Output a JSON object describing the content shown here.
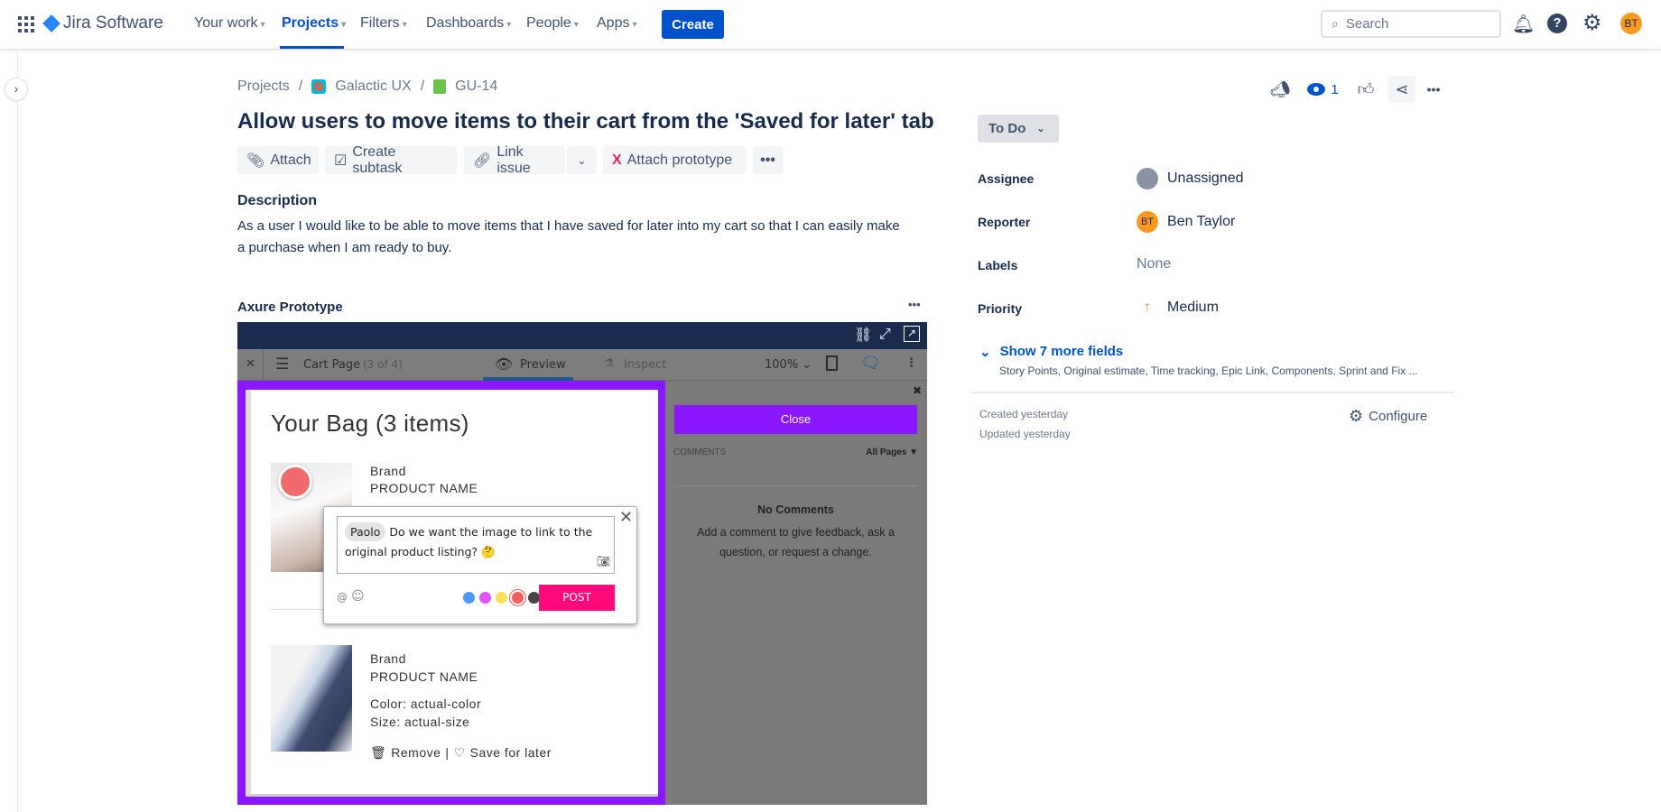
{
  "header": {
    "product": "Jira Software",
    "nav": [
      {
        "label": "Your work"
      },
      {
        "label": "Projects",
        "selected": true
      },
      {
        "label": "Filters"
      },
      {
        "label": "Dashboards"
      },
      {
        "label": "People"
      },
      {
        "label": "Apps"
      }
    ],
    "create": "Create",
    "search_placeholder": "Search",
    "avatar": "BT"
  },
  "breadcrumb": {
    "root": "Projects",
    "project": "Galactic UX",
    "issue": "GU-14"
  },
  "issue": {
    "title": "Allow users to move items to their cart from the 'Saved for later' tab",
    "actions": {
      "attach": "Attach",
      "subtask": "Create subtask",
      "link": "Link issue",
      "prototype": "Attach prototype"
    },
    "description_heading": "Description",
    "description": "As a user I would like to be able to move items that I have saved for later into my cart so that I can easily make a purchase when I am ready to buy.",
    "prototype_heading": "Axure Prototype"
  },
  "prototype": {
    "page": "Cart Page",
    "page_count": "(3 of 4)",
    "tab_preview": "Preview",
    "tab_inspect": "Inspect",
    "zoom": "100%",
    "bag_title": "Your Bag (3 items)",
    "items": [
      {
        "brand": "Brand",
        "name": "PRODUCT NAME"
      },
      {
        "brand": "Brand",
        "name": "PRODUCT NAME",
        "color": "Color: actual-color",
        "size": "Size: actual-size",
        "remove": "Remove",
        "sep": "|",
        "save": "Save for later"
      }
    ],
    "comment": {
      "mention": "Paolo",
      "text": "Do we want the image to link to the original product listing? 🤔",
      "at": "@",
      "emoji": "☺",
      "post": "POST",
      "colors": [
        "#4c9aff",
        "#e056fd",
        "#f6e05e",
        "#f25c5c",
        "#444444"
      ]
    },
    "panel": {
      "close": "Close",
      "comments": "COMMENTS",
      "filter": "All Pages ▼",
      "empty_title": "No Comments",
      "empty_text": "Add a comment to give feedback, ask a question, or request a change."
    },
    "accent": "#8a17ff"
  },
  "side": {
    "watch_count": "1",
    "status": "To Do",
    "fields": [
      {
        "label": "Assignee",
        "value": "Unassigned"
      },
      {
        "label": "Reporter",
        "value": "Ben Taylor",
        "avatar": "BT"
      },
      {
        "label": "Labels",
        "value": "None"
      },
      {
        "label": "Priority",
        "value": "Medium"
      }
    ],
    "more": "Show 7 more fields",
    "more_sub": "Story Points, Original estimate, Time tracking, Epic Link, Components, Sprint and Fix ...",
    "created": "Created yesterday",
    "updated": "Updated yesterday",
    "configure": "Configure"
  }
}
